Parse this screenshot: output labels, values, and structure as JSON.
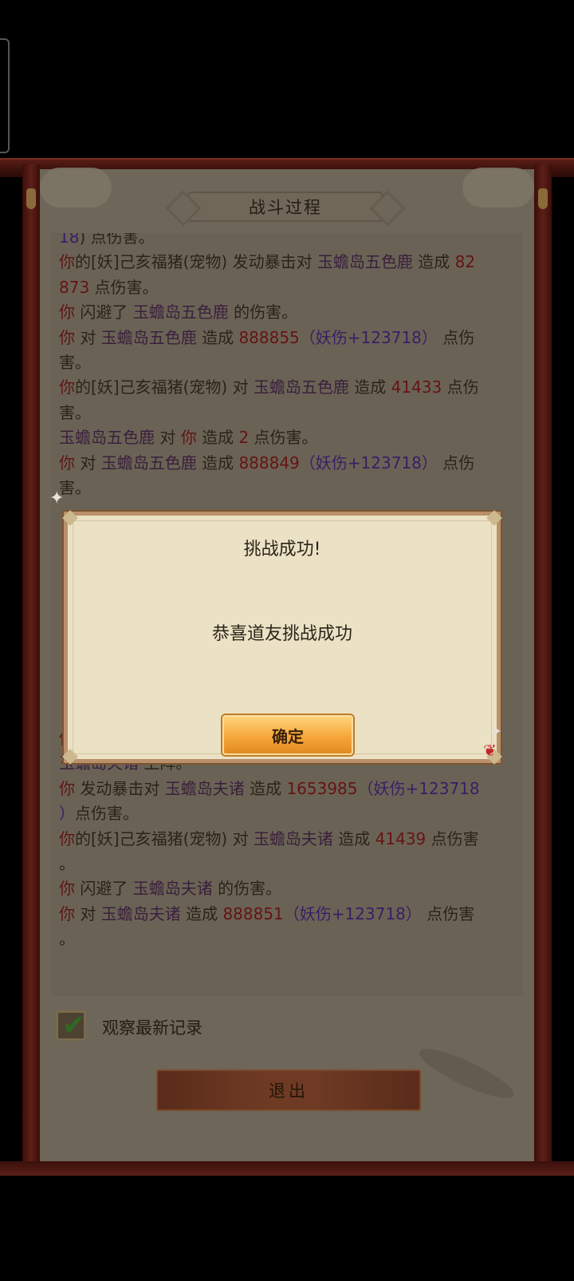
{
  "panel": {
    "title": "战斗过程"
  },
  "log": [
    {
      "segs": [
        {
          "t": "18",
          "c": "yao"
        },
        {
          "t": ") 点伤害。",
          "c": ""
        }
      ]
    },
    {
      "segs": [
        {
          "t": "你",
          "c": "you"
        },
        {
          "t": "的[妖]己亥福猪(宠物) 发动暴击对 ",
          "c": ""
        },
        {
          "t": "玉蟾岛五色鹿",
          "c": "mob"
        },
        {
          "t": " 造成 ",
          "c": ""
        },
        {
          "t": "82",
          "c": "num"
        }
      ]
    },
    {
      "segs": [
        {
          "t": "873",
          "c": "num"
        },
        {
          "t": " 点伤害。",
          "c": ""
        }
      ]
    },
    {
      "segs": [
        {
          "t": "你",
          "c": "you"
        },
        {
          "t": " 闪避了 ",
          "c": ""
        },
        {
          "t": "玉蟾岛五色鹿",
          "c": "mob"
        },
        {
          "t": " 的伤害。",
          "c": ""
        }
      ]
    },
    {
      "segs": [
        {
          "t": "你",
          "c": "you"
        },
        {
          "t": " 对 ",
          "c": ""
        },
        {
          "t": "玉蟾岛五色鹿",
          "c": "mob"
        },
        {
          "t": " 造成 ",
          "c": ""
        },
        {
          "t": "888855",
          "c": "num"
        },
        {
          "t": "（妖伤+123718）",
          "c": "yao"
        },
        {
          "t": " 点伤",
          "c": ""
        }
      ]
    },
    {
      "segs": [
        {
          "t": "害。",
          "c": ""
        }
      ]
    },
    {
      "segs": [
        {
          "t": "你",
          "c": "you"
        },
        {
          "t": "的[妖]己亥福猪(宠物) 对 ",
          "c": ""
        },
        {
          "t": "玉蟾岛五色鹿",
          "c": "mob"
        },
        {
          "t": " 造成 ",
          "c": ""
        },
        {
          "t": "41433",
          "c": "num"
        },
        {
          "t": " 点伤",
          "c": ""
        }
      ]
    },
    {
      "segs": [
        {
          "t": "害。",
          "c": ""
        }
      ]
    },
    {
      "segs": [
        {
          "t": "玉蟾岛五色鹿",
          "c": "mob"
        },
        {
          "t": " 对 ",
          "c": ""
        },
        {
          "t": "你",
          "c": "you"
        },
        {
          "t": " 造成 ",
          "c": ""
        },
        {
          "t": "2",
          "c": "num"
        },
        {
          "t": " 点伤害。",
          "c": ""
        }
      ]
    },
    {
      "segs": [
        {
          "t": "你",
          "c": "you"
        },
        {
          "t": " 对 ",
          "c": ""
        },
        {
          "t": "玉蟾岛五色鹿",
          "c": "mob"
        },
        {
          "t": " 造成 ",
          "c": ""
        },
        {
          "t": "888849",
          "c": "num"
        },
        {
          "t": "（妖伤+123718）",
          "c": "yao"
        },
        {
          "t": " 点伤",
          "c": ""
        }
      ]
    },
    {
      "segs": [
        {
          "t": "害。",
          "c": ""
        }
      ]
    },
    {
      "segs": [
        {
          "t": "",
          "c": ""
        }
      ]
    },
    {
      "segs": [
        {
          "t": "",
          "c": ""
        }
      ]
    },
    {
      "segs": [
        {
          "t": "",
          "c": ""
        }
      ]
    },
    {
      "segs": [
        {
          "t": "",
          "c": ""
        }
      ]
    },
    {
      "segs": [
        {
          "t": "",
          "c": ""
        }
      ]
    },
    {
      "segs": [
        {
          "t": "",
          "c": ""
        }
      ]
    },
    {
      "segs": [
        {
          "t": "",
          "c": ""
        }
      ]
    },
    {
      "segs": [
        {
          "t": "",
          "c": ""
        }
      ]
    },
    {
      "segs": [
        {
          "t": "",
          "c": ""
        }
      ]
    },
    {
      "segs": [
        {
          "t": "你",
          "c": "you"
        },
        {
          "t": " 将 ",
          "c": ""
        },
        {
          "t": "玉蟾岛五色鹿",
          "c": "mob"
        },
        {
          "t": " 打败。",
          "c": ""
        }
      ]
    },
    {
      "segs": [
        {
          "t": "玉蟾岛夫诸",
          "c": "mob"
        },
        {
          "t": " 上阵。",
          "c": ""
        }
      ]
    },
    {
      "segs": [
        {
          "t": "你",
          "c": "you"
        },
        {
          "t": " 发动暴击对 ",
          "c": ""
        },
        {
          "t": "玉蟾岛夫诸",
          "c": "mob"
        },
        {
          "t": " 造成 ",
          "c": ""
        },
        {
          "t": "1653985",
          "c": "num"
        },
        {
          "t": "（妖伤+123718",
          "c": "yao"
        }
      ]
    },
    {
      "segs": [
        {
          "t": "）",
          "c": "yao"
        },
        {
          "t": "点伤害。",
          "c": ""
        }
      ]
    },
    {
      "segs": [
        {
          "t": "你",
          "c": "you"
        },
        {
          "t": "的[妖]己亥福猪(宠物) 对 ",
          "c": ""
        },
        {
          "t": "玉蟾岛夫诸",
          "c": "mob"
        },
        {
          "t": " 造成 ",
          "c": ""
        },
        {
          "t": "41439",
          "c": "num"
        },
        {
          "t": " 点伤害",
          "c": ""
        }
      ]
    },
    {
      "segs": [
        {
          "t": "。",
          "c": ""
        }
      ]
    },
    {
      "segs": [
        {
          "t": "你",
          "c": "you"
        },
        {
          "t": " 闪避了 ",
          "c": ""
        },
        {
          "t": "玉蟾岛夫诸",
          "c": "mob"
        },
        {
          "t": " 的伤害。",
          "c": ""
        }
      ]
    },
    {
      "segs": [
        {
          "t": "你",
          "c": "you"
        },
        {
          "t": " 对 ",
          "c": ""
        },
        {
          "t": "玉蟾岛夫诸",
          "c": "mob"
        },
        {
          "t": " 造成 ",
          "c": ""
        },
        {
          "t": "888851",
          "c": "num"
        },
        {
          "t": "（妖伤+123718）",
          "c": "yao"
        },
        {
          "t": " 点伤害",
          "c": ""
        }
      ]
    },
    {
      "segs": [
        {
          "t": "。",
          "c": ""
        }
      ]
    }
  ],
  "watch_latest": {
    "label": "观察最新记录",
    "checked": true
  },
  "exit_button": {
    "label": "退出"
  },
  "dialog": {
    "title": "挑战成功!",
    "message": "恭喜道友挑战成功",
    "ok_label": "确定"
  },
  "icons": {
    "check": "check-icon",
    "sparkle": "sparkle-icon"
  }
}
